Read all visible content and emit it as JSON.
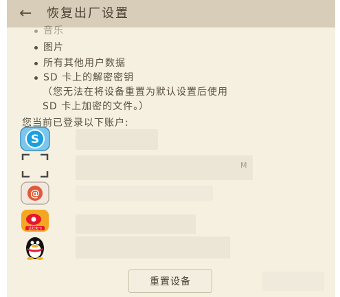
{
  "header": {
    "back_icon": "arrow-left-icon",
    "title": "恢复出厂设置"
  },
  "list": {
    "partial_item": "音乐",
    "items": [
      "图片",
      "所有其他用户数据",
      "SD 卡上的解密密钥"
    ],
    "note_line1": "（您无法在将设备重置为默认设置后使用",
    "note_line2": "SD 卡上加密的文件。）"
  },
  "accounts": {
    "heading": "您当前已登录以下账户:",
    "fragment_text": "M",
    "icons": [
      {
        "name": "skype-icon",
        "color": "#1aa0e0"
      },
      {
        "name": "scan-frame-icon",
        "color": "#4a4a4a"
      },
      {
        "name": "email-icon",
        "color": "#e05a3a"
      },
      {
        "name": "weibo-icon",
        "color": "#e6162d",
        "label": "让红包飞"
      },
      {
        "name": "qq-penguin-icon",
        "color": "#111111"
      }
    ]
  },
  "footer": {
    "reset_label": "重置设备"
  }
}
